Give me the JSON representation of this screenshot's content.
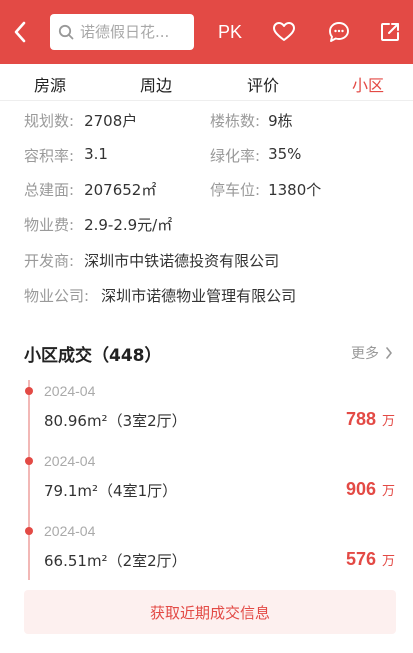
{
  "header": {
    "search_placeholder": "诺德假日花...",
    "pk_label": "PK"
  },
  "tabs": [
    {
      "label": "房源"
    },
    {
      "label": "周边"
    },
    {
      "label": "评价"
    },
    {
      "label": "小区"
    }
  ],
  "info": {
    "planned_units_label": "规划数:",
    "planned_units_value": "2708户",
    "buildings_label": "楼栋数:",
    "buildings_value": "9栋",
    "plot_ratio_label": "容积率:",
    "plot_ratio_value": "3.1",
    "green_label": "绿化率:",
    "green_value": "35%",
    "area_label": "总建面:",
    "area_value": "207652㎡",
    "parking_label": "停车位:",
    "parking_value": "1380个",
    "fee_label": "物业费:",
    "fee_value": "2.9-2.9元/㎡",
    "developer_label": "开发商:",
    "developer_value": "深圳市中铁诺德投资有限公司",
    "property_co_label": "物业公司:",
    "property_co_value": "深圳市诺德物业管理有限公司"
  },
  "transactions": {
    "title": "小区成交（448）",
    "more_label": "更多",
    "items": [
      {
        "date": "2024-04",
        "desc": "80.96m²（3室2厅）",
        "price": "788",
        "unit": "万"
      },
      {
        "date": "2024-04",
        "desc": "79.1m²（4室1厅）",
        "price": "906",
        "unit": "万"
      },
      {
        "date": "2024-04",
        "desc": "66.51m²（2室2厅）",
        "price": "576",
        "unit": "万"
      }
    ],
    "cta_label": "获取近期成交信息"
  },
  "colors": {
    "brand": "#e34a45",
    "timeline": "#f2b8b6",
    "cta_bg": "#fdf0ef"
  }
}
